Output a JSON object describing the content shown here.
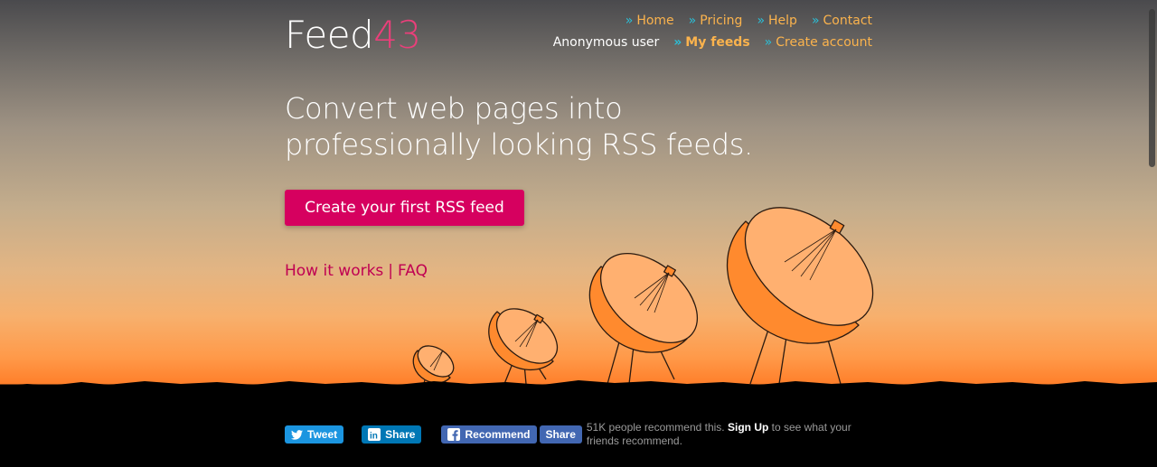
{
  "logo": {
    "text": "Feed",
    "number": "43"
  },
  "nav": {
    "row1": [
      {
        "label": "Home"
      },
      {
        "label": "Pricing"
      },
      {
        "label": "Help"
      },
      {
        "label": "Contact"
      }
    ],
    "user": "Anonymous user",
    "row2": [
      {
        "label": "My feeds"
      },
      {
        "label": "Create account"
      }
    ],
    "chevron": "»"
  },
  "hero": {
    "line1": "Convert web pages into",
    "line2": "professionally looking RSS feeds.",
    "cta": "Create your first RSS feed",
    "link1": "How it works",
    "separator": "|",
    "link2": "FAQ"
  },
  "social": {
    "tweet": "Tweet",
    "linkedin_share": "Share",
    "fb_recommend": "Recommend",
    "fb_share": "Share",
    "fb_text_before": "51K people recommend this.",
    "fb_signup": "Sign Up",
    "fb_text_after": "to see what your friends recommend."
  },
  "icons": {
    "twitter": "twitter-bird-icon",
    "linkedin": "linkedin-icon",
    "facebook": "facebook-icon"
  },
  "colors": {
    "accent_pink": "#d6005f",
    "nav_link": "#fbb34d",
    "nav_chevron": "#2bbfd7",
    "logo_number": "#ea3f7a",
    "dish_orange": "#ff8a2e"
  }
}
